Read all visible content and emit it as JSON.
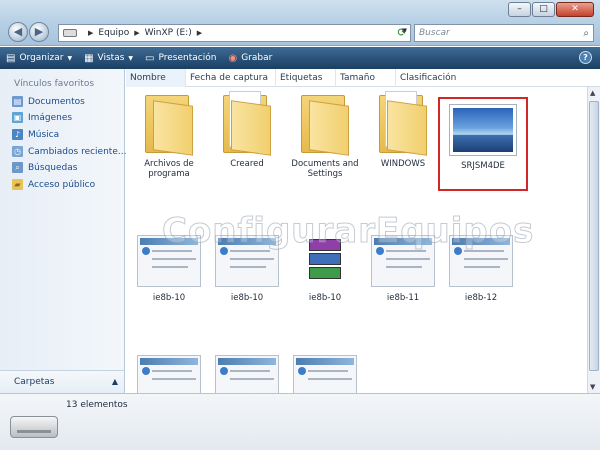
{
  "address": {
    "path": [
      "Equipo",
      "WinXP (E:)"
    ],
    "search_placeholder": "Buscar"
  },
  "toolbar": {
    "organize_label": "Organizar",
    "views_label": "Vistas",
    "slideshow_label": "Presentación",
    "burn_label": "Grabar"
  },
  "sidebar": {
    "title": "Vínculos favoritos",
    "items": [
      {
        "label": "Documentos",
        "icon": "documents-icon"
      },
      {
        "label": "Imágenes",
        "icon": "pictures-icon"
      },
      {
        "label": "Música",
        "icon": "music-icon"
      },
      {
        "label": "Cambiados reciente...",
        "icon": "recent-icon"
      },
      {
        "label": "Búsquedas",
        "icon": "searches-icon"
      },
      {
        "label": "Acceso público",
        "icon": "public-icon"
      }
    ],
    "folders_label": "Carpetas"
  },
  "columns": [
    "Nombre",
    "Fecha de captura",
    "Etiquetas",
    "Tamaño",
    "Clasificación"
  ],
  "files": [
    {
      "name": "Archivos de programa",
      "type": "folder"
    },
    {
      "name": "Creared",
      "type": "folder"
    },
    {
      "name": "Documents and Settings",
      "type": "folder"
    },
    {
      "name": "WINDOWS",
      "type": "folder"
    },
    {
      "name": "SRJSM4DE",
      "type": "image",
      "selected": true
    },
    {
      "name": "ie8b-10",
      "type": "screenshot"
    },
    {
      "name": "ie8b-10",
      "type": "screenshot"
    },
    {
      "name": "ie8b-10",
      "type": "archive"
    },
    {
      "name": "ie8b-11",
      "type": "screenshot"
    },
    {
      "name": "ie8b-12",
      "type": "screenshot"
    },
    {
      "name": "",
      "type": "screenshot"
    },
    {
      "name": "",
      "type": "screenshot"
    },
    {
      "name": "",
      "type": "screenshot"
    }
  ],
  "watermark": "ConfigurarEquipos",
  "status": {
    "count_label": "13 elementos"
  },
  "colors": {
    "toolbar": "#2a5279",
    "selection_box": "#d32626",
    "folder": "#f1cf6e"
  }
}
